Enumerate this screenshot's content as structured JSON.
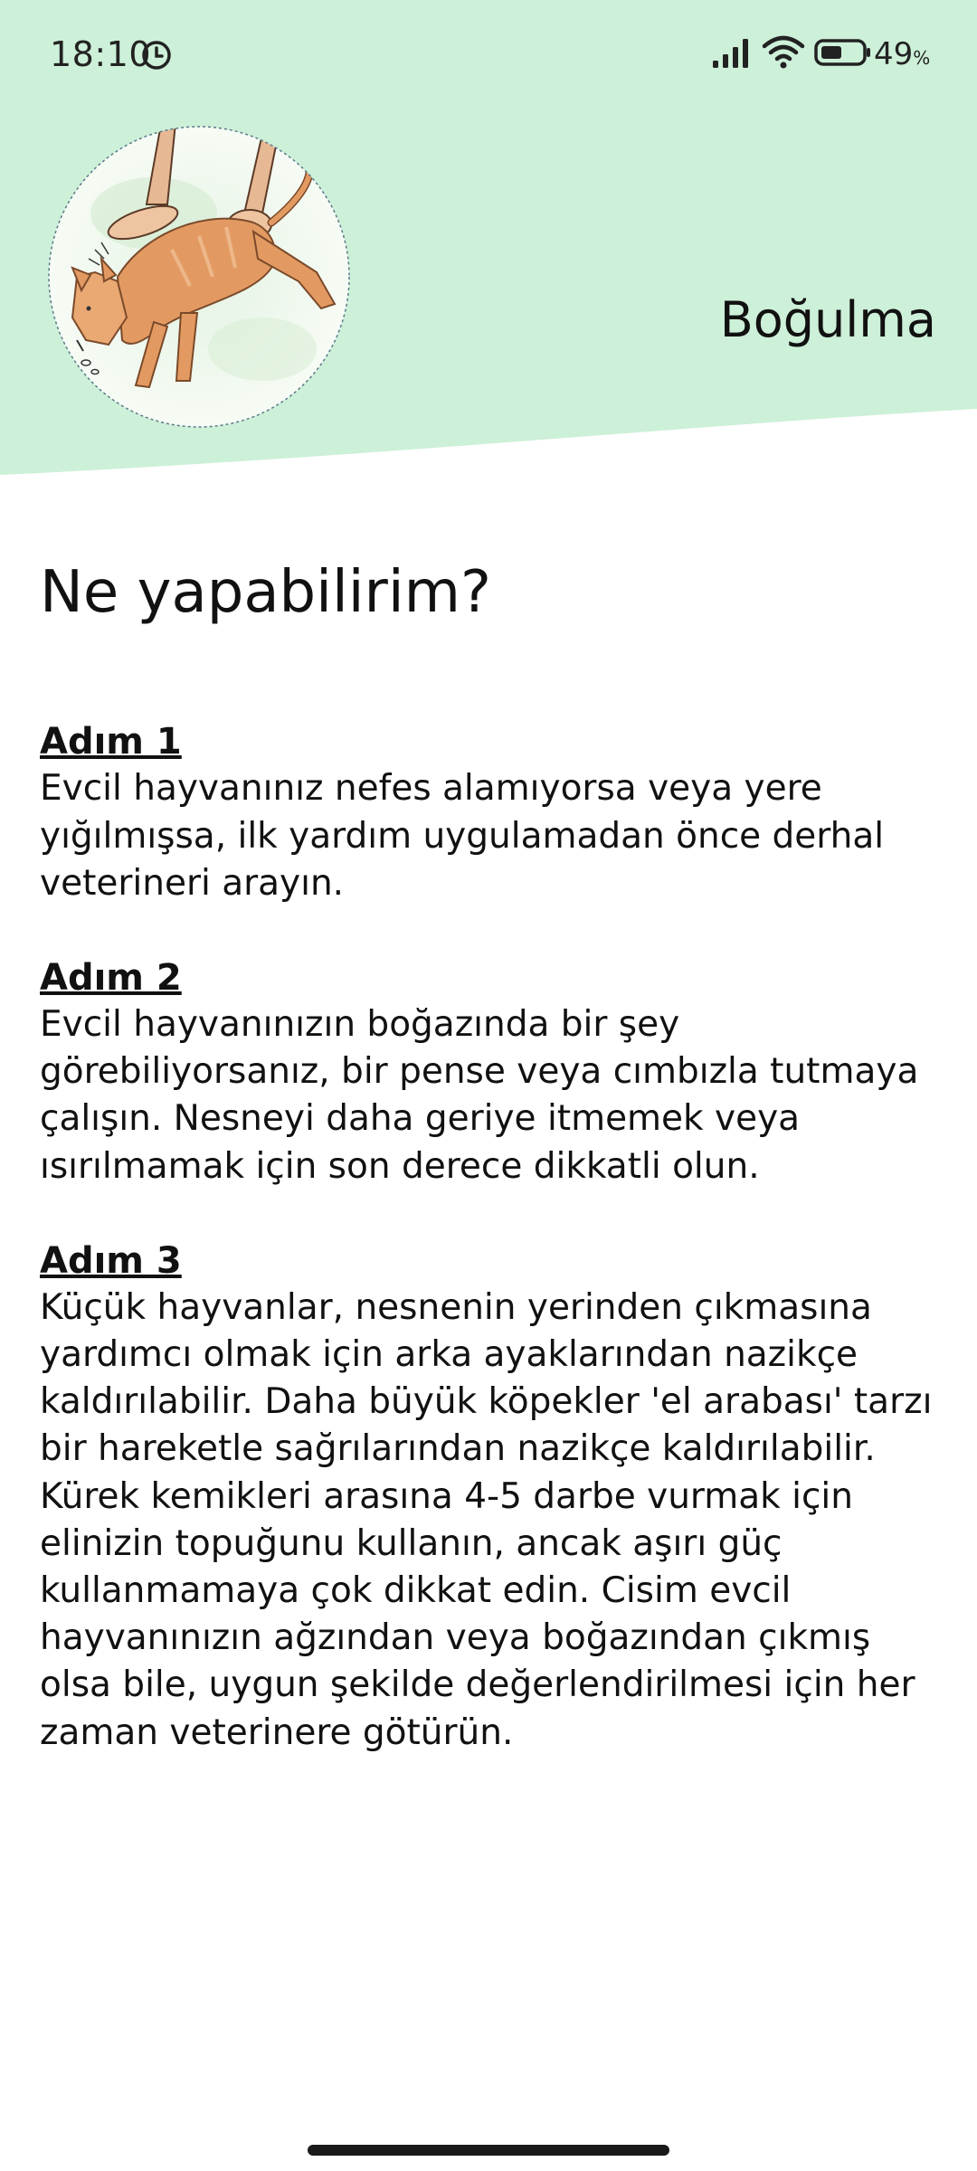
{
  "status_bar": {
    "time": "18:10",
    "battery_value": "49",
    "battery_unit": "%"
  },
  "header": {
    "title": "Boğulma",
    "background_color": "#cdf0d8"
  },
  "content": {
    "heading": "Ne yapabilirim?",
    "steps": [
      {
        "title": "Adım 1",
        "text": "Evcil hayvanınız nefes alamıyorsa veya yere yığılmışsa, ilk yardım uygulamadan önce derhal veterineri arayın."
      },
      {
        "title": "Adım 2",
        "text": "Evcil hayvanınızın boğazında bir şey görebiliyorsanız, bir pense veya cımbızla tutmaya çalışın. Nesneyi daha geriye itmemek veya ısırılmamak için son derece dikkatli olun."
      },
      {
        "title": "Adım 3",
        "text": "Küçük hayvanlar, nesnenin yerinden çıkmasına yardımcı olmak için arka ayaklarından nazikçe kaldırılabilir. Daha büyük köpekler 'el arabası' tarzı bir hareketle sağrılarından nazikçe kaldırılabilir. Kürek kemikleri arasına 4-5 darbe vurmak için elinizin topuğunu kullanın, ancak aşırı güç kullanmamaya çok dikkat edin. Cisim evcil hayvanınızın ağzından veya boğazından çıkmış olsa bile, uygun şekilde değerlendirilmesi için her zaman veterinere götürün."
      }
    ]
  },
  "icons": {
    "clock": "clock-icon",
    "signal": "signal-icon",
    "wifi": "wifi-icon",
    "battery": "battery-icon",
    "illustration": "dog-choking-illustration"
  }
}
